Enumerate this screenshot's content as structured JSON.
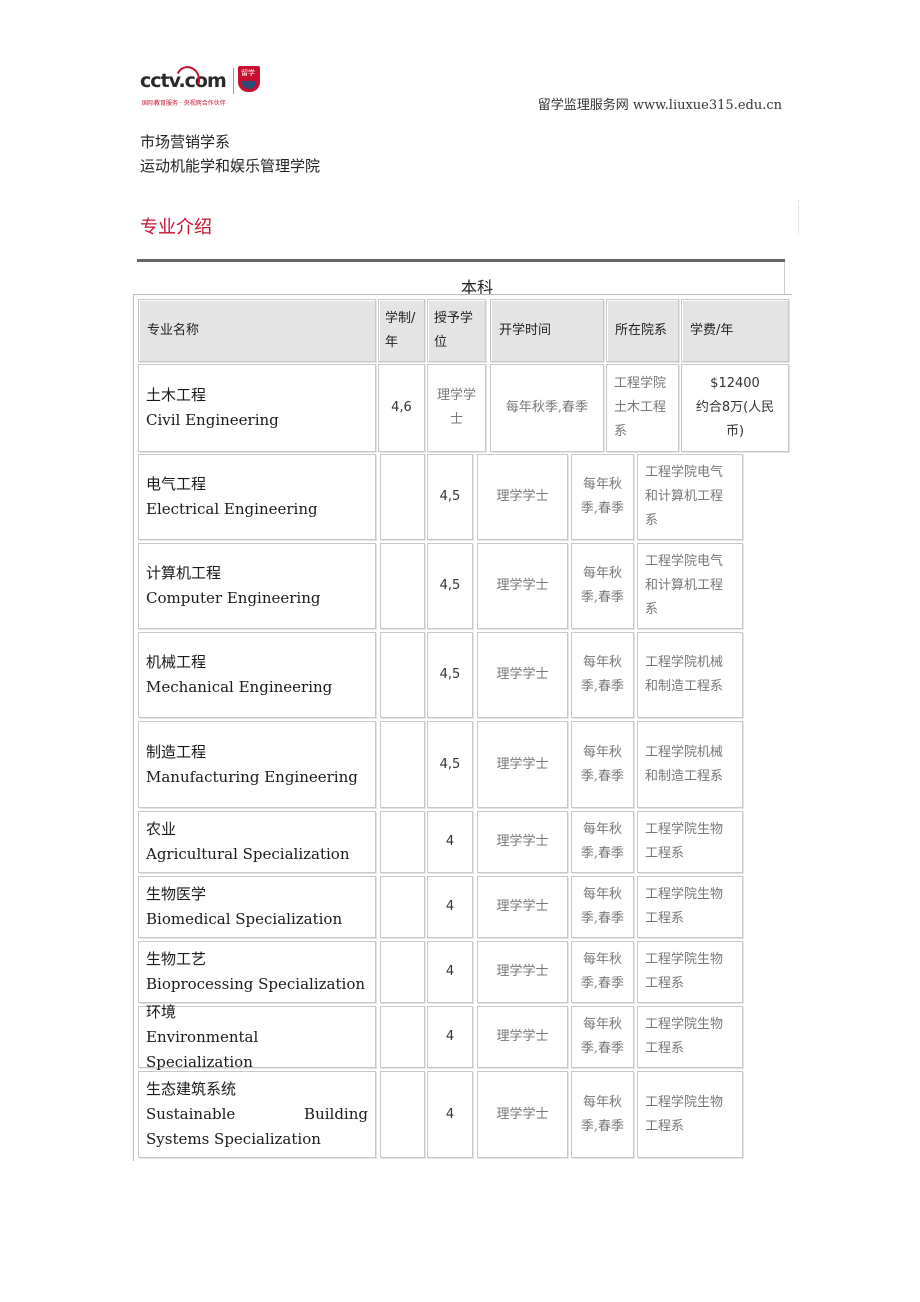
{
  "header": {
    "logo_text": "cctv.com",
    "logo_badge": "留学",
    "logo_tagline": "国际教育服务 · 央视网合作伙伴",
    "site_name": "留学监理服务网 www.liuxue315.edu.cn"
  },
  "intro_lines": [
    "市场营销学系",
    "运动机能学和娱乐管理学院"
  ],
  "section_title": "专业介绍",
  "table": {
    "caption": "本科",
    "headers": [
      "专业名称",
      "学制/年",
      "授予学位",
      "开学时间",
      "所在院系",
      "学费/年"
    ],
    "first_row": {
      "name_cn": "土木工程",
      "name_en": "Civil Engineering",
      "years": "4,6",
      "degree": "理学学士",
      "start": "每年秋季,春季",
      "dept": "工程学院土木工程系",
      "fee_usd": "$12400",
      "fee_rmb": "约合8万(人民币)"
    },
    "rows": [
      {
        "name_cn": "电气工程",
        "name_en": "Electrical Engineering",
        "years": "4,5",
        "degree": "理学学士",
        "start": "每年秋季,春季",
        "dept": "工程学院电气和计算机工程系"
      },
      {
        "name_cn": "计算机工程",
        "name_en": "Computer Engineering",
        "years": "4,5",
        "degree": "理学学士",
        "start": "每年秋季,春季",
        "dept": "工程学院电气和计算机工程系"
      },
      {
        "name_cn": "机械工程",
        "name_en": "Mechanical Engineering",
        "years": "4,5",
        "degree": "理学学士",
        "start": "每年秋季,春季",
        "dept": "工程学院机械和制造工程系"
      },
      {
        "name_cn": "制造工程",
        "name_en": "Manufacturing Engineering",
        "years": "4,5",
        "degree": "理学学士",
        "start": "每年秋季,春季",
        "dept": "工程学院机械和制造工程系"
      },
      {
        "name_cn": "农业",
        "name_en": "Agricultural Specialization",
        "years": "4",
        "degree": "理学学士",
        "start": "每年秋季,春季",
        "dept": "工程学院生物工程系"
      },
      {
        "name_cn": "生物医学",
        "name_en": "Biomedical Specialization",
        "years": "4",
        "degree": "理学学士",
        "start": "每年秋季,春季",
        "dept": "工程学院生物工程系"
      },
      {
        "name_cn": "生物工艺",
        "name_en": "Bioprocessing Specialization",
        "years": "4",
        "degree": "理学学士",
        "start": "每年秋季,春季",
        "dept": "工程学院生物工程系"
      },
      {
        "name_cn": "环境",
        "name_en": "Environmental Specialization",
        "years": "4",
        "degree": "理学学士",
        "start": "每年秋季,春季",
        "dept": "工程学院生物工程系"
      },
      {
        "name_cn": "生态建筑系统",
        "name_en": "Sustainable Building Systems Specialization",
        "years": "4",
        "degree": "理学学士",
        "start": "每年秋季,春季",
        "dept": "工程学院生物工程系"
      }
    ]
  }
}
